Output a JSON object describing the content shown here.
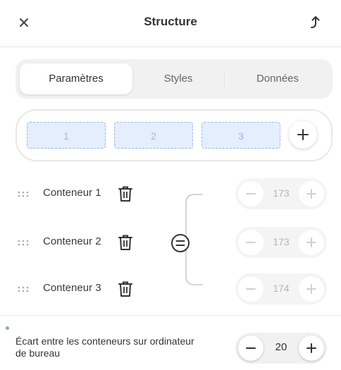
{
  "header": {
    "title": "Structure",
    "close_icon": "close-icon",
    "collapse_icon": "collapse-arrow-icon"
  },
  "tabs": [
    {
      "label": "Paramètres",
      "active": true
    },
    {
      "label": "Styles",
      "active": false
    },
    {
      "label": "Données",
      "active": false
    }
  ],
  "columns": {
    "items": [
      "1",
      "2",
      "3"
    ],
    "add_icon": "plus-icon",
    "accent_color": "#9cb9e8"
  },
  "containers": [
    {
      "label": "Conteneur 1",
      "value": "173"
    },
    {
      "label": "Conteneur 2",
      "value": "173"
    },
    {
      "label": "Conteneur 3",
      "value": "174"
    }
  ],
  "equalize_icon": "equal-sizes-icon",
  "gap": {
    "label": "Écart entre les conteneurs sur ordinateur de bureau",
    "value": "20"
  }
}
